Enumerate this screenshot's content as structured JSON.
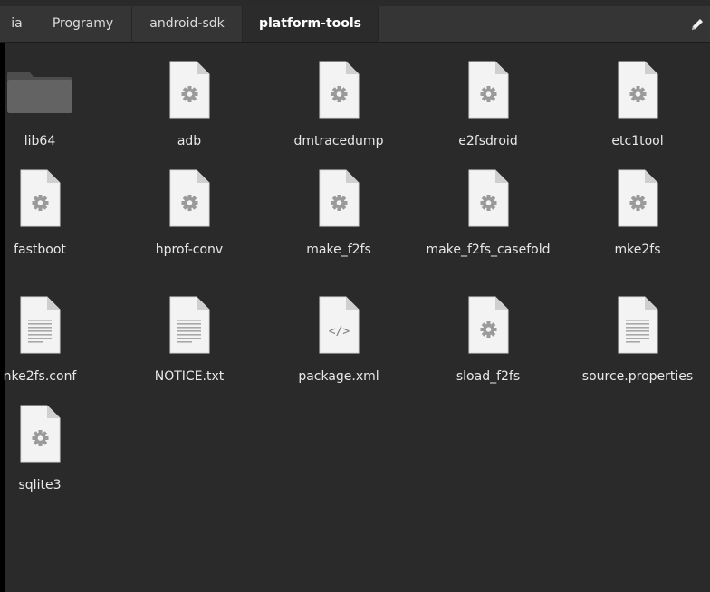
{
  "pathbar": {
    "crumbs": [
      {
        "label": "ia"
      },
      {
        "label": "Programy"
      },
      {
        "label": "android-sdk"
      },
      {
        "label": "platform-tools",
        "active": true
      }
    ],
    "edit_icon": "pencil-icon"
  },
  "files": [
    {
      "name": "lib64",
      "icon": "folder-icon"
    },
    {
      "name": "adb",
      "icon": "executable-icon"
    },
    {
      "name": "dmtracedump",
      "icon": "executable-icon"
    },
    {
      "name": "e2fsdroid",
      "icon": "executable-icon"
    },
    {
      "name": "etc1tool",
      "icon": "executable-icon"
    },
    {
      "name": "fastboot",
      "icon": "executable-icon"
    },
    {
      "name": "hprof-conv",
      "icon": "executable-icon"
    },
    {
      "name": "make_f2fs",
      "icon": "executable-icon"
    },
    {
      "name": "make_f2fs_casefold",
      "icon": "executable-icon"
    },
    {
      "name": "mke2fs",
      "icon": "executable-icon"
    },
    {
      "name": "nke2fs.conf",
      "icon": "text-file-icon"
    },
    {
      "name": "NOTICE.txt",
      "icon": "text-file-icon"
    },
    {
      "name": "package.xml",
      "icon": "code-file-icon"
    },
    {
      "name": "sload_f2fs",
      "icon": "executable-icon"
    },
    {
      "name": "source.properties",
      "icon": "text-file-icon"
    },
    {
      "name": "sqlite3",
      "icon": "executable-icon"
    }
  ],
  "colors": {
    "background": "#2a2a2a",
    "pathbar": "#353535",
    "folder": "#5f5f5f",
    "document": "#f2f2f2"
  }
}
